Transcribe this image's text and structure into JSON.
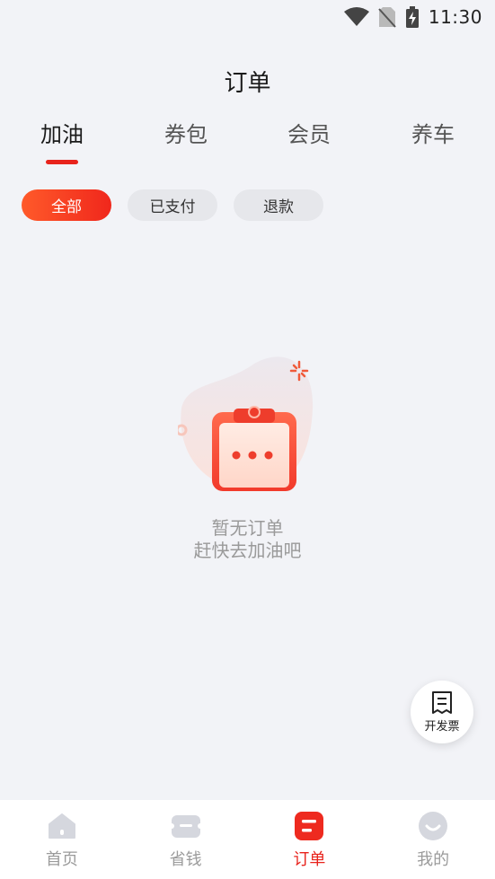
{
  "status_bar": {
    "time": "11:30"
  },
  "header": {
    "title": "订单"
  },
  "tabs": [
    {
      "label": "加油",
      "active": true
    },
    {
      "label": "券包",
      "active": false
    },
    {
      "label": "会员",
      "active": false
    },
    {
      "label": "养车",
      "active": false
    }
  ],
  "filters": [
    {
      "label": "全部",
      "active": true
    },
    {
      "label": "已支付",
      "active": false
    },
    {
      "label": "退款",
      "active": false
    }
  ],
  "empty_state": {
    "line1": "暂无订单",
    "line2": "赶快去加油吧",
    "icon": "clipboard-icon"
  },
  "invoice_button": {
    "label": "开发票",
    "icon": "receipt-icon"
  },
  "bottom_nav": [
    {
      "label": "首页",
      "icon": "home-icon",
      "active": false
    },
    {
      "label": "省钱",
      "icon": "ticket-icon",
      "active": false
    },
    {
      "label": "订单",
      "icon": "order-icon",
      "active": true
    },
    {
      "label": "我的",
      "icon": "profile-icon",
      "active": false
    }
  ],
  "colors": {
    "accent": "#e8231c",
    "background": "#f2f3f7",
    "inactive_icon": "#d5d7de"
  }
}
